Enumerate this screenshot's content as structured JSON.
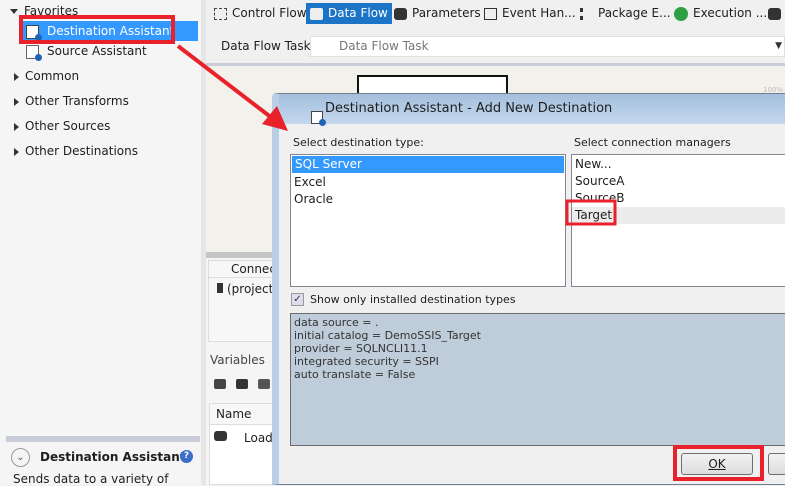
{
  "toolbox": {
    "favorites": "Favorites",
    "destination_assistant": "Destination Assistant",
    "source_assistant": "Source Assistant",
    "groups": [
      "Common",
      "Other Transforms",
      "Other Sources",
      "Other Destinations"
    ],
    "info_title": "Destination Assistant",
    "info_desc": "Sends data to a variety of"
  },
  "tabs": [
    "Control Flow",
    "Data Flow",
    "Parameters",
    "Event Han...",
    "Package E...",
    "Execution ..."
  ],
  "task": {
    "label": "Data Flow Task:",
    "value": "Data Flow Task"
  },
  "canvas": {
    "zoom": "100%"
  },
  "connections": {
    "header": "Connect",
    "item": "(project)"
  },
  "variables": {
    "title": "Variables",
    "name_header": "Name",
    "row": "Load"
  },
  "dialog": {
    "title": "Destination Assistant - Add New Destination",
    "type_label": "Select destination type:",
    "types": [
      "SQL Server",
      "Excel",
      "Oracle"
    ],
    "cm_label": "Select connection managers",
    "managers": [
      "New...",
      "SourceA",
      "SourceB",
      "Target"
    ],
    "checkbox_label": "Show only installed destination types",
    "info": [
      "data source = .",
      "initial catalog = DemoSSIS_Target",
      "provider = SQLNCLI11.1",
      "integrated security = SSPI",
      "auto translate = False"
    ],
    "ok": "OK"
  },
  "colors": {
    "selection": "#3399ff",
    "annotation": "#e8212b"
  }
}
